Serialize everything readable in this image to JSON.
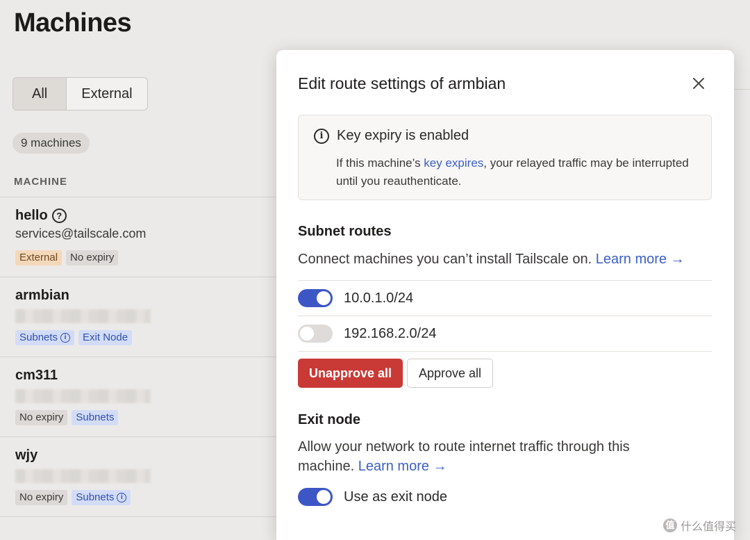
{
  "page": {
    "title": "Machines"
  },
  "filters": [
    {
      "label": "All",
      "active": true
    },
    {
      "label": "External",
      "active": false
    }
  ],
  "machine_count": "9 machines",
  "columns": {
    "machine": "MACHINE"
  },
  "machines": [
    {
      "name": "hello",
      "subtitle": "services@tailscale.com",
      "tags": [
        {
          "label": "External",
          "style": "orange"
        },
        {
          "label": "No expiry",
          "style": "gray"
        }
      ]
    },
    {
      "name": "armbian",
      "subtitle": "",
      "tags": [
        {
          "label": "Subnets",
          "style": "blue"
        },
        {
          "label": "Exit Node",
          "style": "blue"
        }
      ]
    },
    {
      "name": "cm311",
      "subtitle": "",
      "tags": [
        {
          "label": "No expiry",
          "style": "gray"
        },
        {
          "label": "Subnets",
          "style": "blue"
        }
      ]
    },
    {
      "name": "wjy",
      "subtitle": "",
      "tags": [
        {
          "label": "No expiry",
          "style": "gray"
        },
        {
          "label": "Subnets",
          "style": "blue"
        }
      ]
    }
  ],
  "modal": {
    "title": "Edit route settings of armbian",
    "alert": {
      "title": "Key expiry is enabled",
      "body_before": "If this machine’s ",
      "body_link": "key expires",
      "body_after": ", your relayed traffic may be interrupted until you reauthenticate."
    },
    "subnet": {
      "title": "Subnet routes",
      "desc": "Connect machines you can’t install Tailscale on.",
      "learn_more": "Learn more →",
      "routes": [
        {
          "cidr": "10.0.1.0/24",
          "enabled": true
        },
        {
          "cidr": "192.168.2.0/24",
          "enabled": false
        }
      ],
      "unapprove_all": "Unapprove all",
      "approve_all": "Approve all"
    },
    "exit_node": {
      "title": "Exit node",
      "desc": "Allow your network to route internet traffic through this machine.",
      "learn_more": "Learn more →",
      "toggle_label": "Use as exit node",
      "enabled": true
    }
  },
  "watermark": "什么值得买",
  "colors": {
    "accent": "#3d56c6",
    "danger": "#c93a36",
    "link": "#3a5fc7"
  }
}
